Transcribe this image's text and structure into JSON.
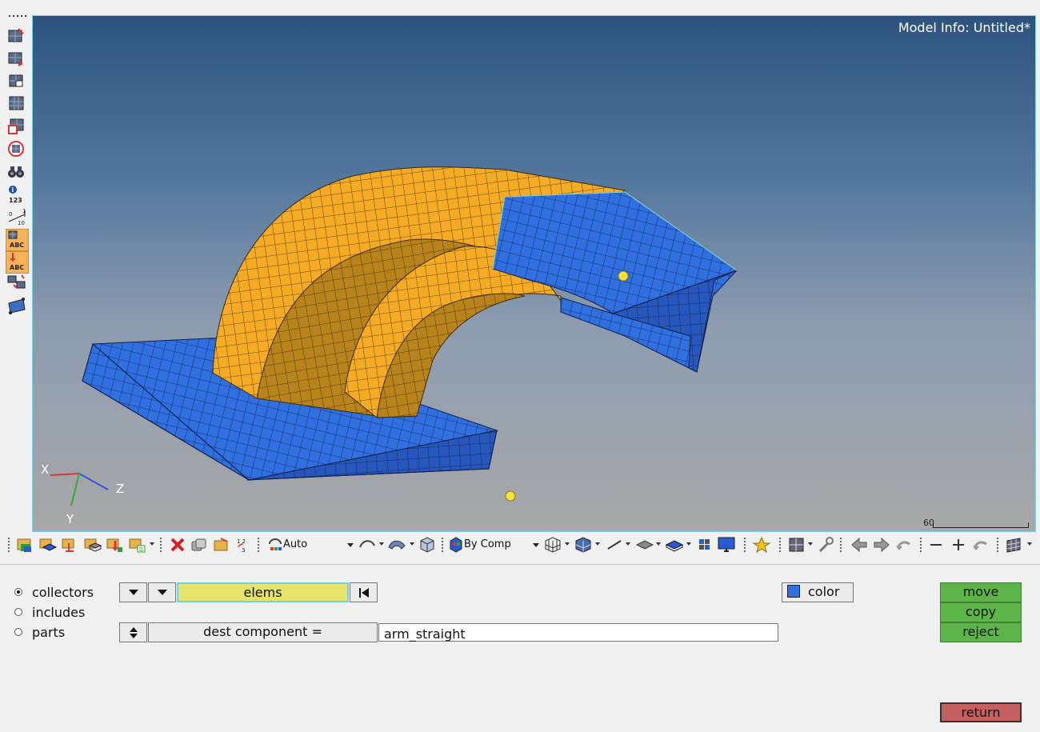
{
  "viewport": {
    "model_info": "Model Info: Untitled*",
    "scale_label": "60",
    "axes": {
      "x": "X",
      "y": "Y",
      "z": "Z"
    },
    "colors": {
      "orange": "#f5aa24",
      "blue": "#2f6fe0",
      "accent": "#7fcfe0"
    }
  },
  "left_toolbar": {
    "icons": [
      "dots-handle-icon",
      "mask-icon",
      "unmask-icon",
      "reverse-icon",
      "show-all-icon",
      "find-icon",
      "isolate-icon",
      "binoculars-icon",
      "count-icon",
      "distance-icon",
      "abc-label-icon",
      "abc-down-icon",
      "transform-icon",
      "surface-icon"
    ],
    "count_label": "123",
    "distance_labels": [
      "0",
      "1",
      "10"
    ],
    "abc_label": "ABC"
  },
  "toolbar": {
    "geometry_mode": "Auto",
    "color_mode": "By Comp",
    "accent": "#d83030"
  },
  "panel": {
    "radios": [
      {
        "label": "collectors",
        "selected": true
      },
      {
        "label": "includes",
        "selected": false
      },
      {
        "label": "parts",
        "selected": false
      }
    ],
    "entity_selector": "elems",
    "dest_label": "dest component =",
    "dest_value": "arm_straight",
    "color_label": "color",
    "color_swatch": "#2f6fe0",
    "actions": {
      "move": "move",
      "copy": "copy",
      "reject": "reject"
    },
    "return_label": "return"
  }
}
